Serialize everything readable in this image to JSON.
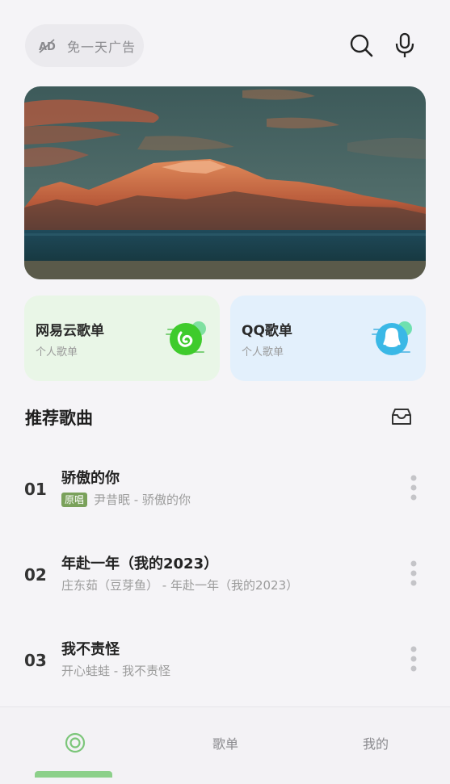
{
  "header": {
    "ad_free_label": "免一天广告",
    "ad_icon": "no-ad-icon",
    "search_icon": "search-icon",
    "mic_icon": "microphone-icon"
  },
  "banner": {
    "image": "snow-mountain-sunset-lake"
  },
  "playlists": [
    {
      "title": "网易云歌单",
      "subtitle": "个人歌单",
      "icon": "netease-music-logo",
      "color": "#3fcb2c"
    },
    {
      "title": "QQ歌单",
      "subtitle": "个人歌单",
      "icon": "qq-penguin-logo",
      "color": "#3ab8e6"
    }
  ],
  "recommended": {
    "title": "推荐歌曲",
    "box_icon": "inbox-icon",
    "songs": [
      {
        "num": "01",
        "title": "骄傲的你",
        "tag": "原唱",
        "meta": "尹昔眠 - 骄傲的你"
      },
      {
        "num": "02",
        "title": "年赴一年（我的2023）",
        "tag": "",
        "meta": "庄东茹（豆芽鱼） - 年赴一年（我的2023）"
      },
      {
        "num": "03",
        "title": "我不责怪",
        "tag": "",
        "meta": "开心蛙蛙 - 我不责怪"
      }
    ]
  },
  "tabbar": {
    "tabs": [
      {
        "label": "",
        "icon": "music-disc-icon",
        "active": true
      },
      {
        "label": "歌单",
        "active": false
      },
      {
        "label": "我的",
        "active": false
      }
    ],
    "accent": "#8cd08a"
  }
}
